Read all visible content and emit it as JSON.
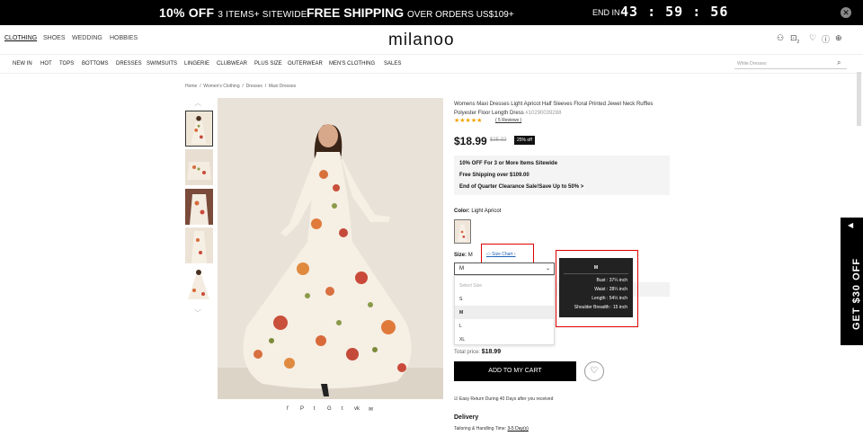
{
  "promo": {
    "offer1_big": "10% OFF",
    "offer1_small": "3 ITEMS+ SITEWIDE",
    "offer2_big": "FREE SHIPPING",
    "offer2_small": "OVER ORDERS US$109+",
    "end_in": "END IN",
    "timer": "43 : 59 : 56",
    "close_icon": "close-icon"
  },
  "topnav": {
    "categories": [
      "CLOTHING",
      "SHOES",
      "WEDDING",
      "HOBBIES"
    ],
    "logo": "milanoo",
    "cart_count": "2",
    "icons": [
      "user-icon",
      "bag-icon",
      "heart-icon",
      "help-icon",
      "globe-icon"
    ]
  },
  "mainnav": {
    "items": [
      "NEW IN",
      "HOT",
      "TOPS",
      "BOTTOMS",
      "DRESSES",
      "SWIMSUITS",
      "LINGERIE",
      "CLUBWEAR",
      "PLUS SIZE",
      "OUTERWEAR",
      "MEN'S CLOTHING",
      "SALES"
    ],
    "search_placeholder": "White Dresses"
  },
  "breadcrumb": [
    "Home",
    "Women's Clothing",
    "Dresses",
    "Maxi Dresses"
  ],
  "product": {
    "title": "Womens Maxi Dresses Light Apricot Half Sleeves Floral Printed Jewel Neck Ruffles Polyester Floor Length Dress",
    "sku": "#10290039288",
    "rating_stars": "★★★★★",
    "reviews": "( 5 Reviews )",
    "price": "$18.99",
    "old_price": "$25.32",
    "discount": "25% off",
    "promos": [
      "10% OFF For 3 or More Items Sitewide",
      "Free Shipping over $109.00",
      "End of Quarter Clearance Sale!Save Up to 50%  >"
    ],
    "color_label": "Color:",
    "color_value": "Light Apricot",
    "size_label": "Size:",
    "size_value": "M",
    "size_chart": "Size Chart",
    "selected_size": "M",
    "size_options": [
      "Select Size",
      "S",
      "M",
      "L",
      "XL"
    ],
    "tooltip": {
      "title": "M",
      "rows": [
        "Bust : 37¼ inch",
        "Waist : 28¼ inch",
        "Length : 54½ inch",
        "Shoulder Breadth : 15 inch"
      ]
    },
    "total_label": "Total price:",
    "total_value": "$18.99",
    "add_to_cart": "ADD TO MY CART",
    "easy_return": "Easy Return During 40 Days after you received",
    "delivery": "Delivery",
    "tailoring_label": "Tailoring & Handling Time:",
    "tailoring_value": "3-5 Day(s)"
  },
  "share_icons": [
    "f",
    "P",
    "t",
    "G",
    "t",
    "vk",
    "✉"
  ],
  "side_banner": "GET $30 OFF"
}
